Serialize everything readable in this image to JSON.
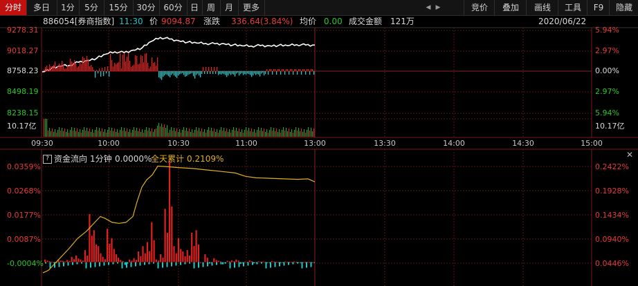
{
  "tabs": {
    "left": [
      {
        "label": "分时",
        "active": true
      },
      {
        "label": "多日",
        "active": false
      },
      {
        "label": "1分",
        "active": false
      },
      {
        "label": "5分",
        "active": false
      },
      {
        "label": "15分",
        "active": false
      },
      {
        "label": "30分",
        "active": false
      },
      {
        "label": "60分",
        "active": false
      },
      {
        "label": "日",
        "active": false
      },
      {
        "label": "周",
        "active": false
      },
      {
        "label": "月",
        "active": false
      },
      {
        "label": "更多",
        "active": false
      }
    ],
    "right": [
      {
        "label": "竞价"
      },
      {
        "label": "叠加"
      },
      {
        "label": "画线"
      },
      {
        "label": "工具"
      },
      {
        "label": "F9"
      },
      {
        "label": "隐藏"
      }
    ],
    "prev_icon": "triangle-left",
    "next_icon": "triangle-right"
  },
  "info": {
    "code_name": "886054[券商指数]",
    "time": "11:30",
    "price_label": "价",
    "price": "9094.87",
    "change_label": "涨跌",
    "change": "336.64(3.84%)",
    "avg_label": "均价",
    "avg": "0.00",
    "amount_label": "成交金额",
    "amount": "121万",
    "date": "2020/06/22"
  },
  "price_axis": {
    "left": [
      {
        "text": "9278.31",
        "color": "#e83a3a"
      },
      {
        "text": "9018.27",
        "color": "#e83a3a"
      },
      {
        "text": "8758.23",
        "color": "#dddddd"
      },
      {
        "text": "8498.19",
        "color": "#28c828"
      },
      {
        "text": "8238.15",
        "color": "#28c828"
      }
    ],
    "right": [
      {
        "text": "5.94%",
        "color": "#e83a3a"
      },
      {
        "text": "2.97%",
        "color": "#e83a3a"
      },
      {
        "text": "0.00%",
        "color": "#dddddd"
      },
      {
        "text": "2.97%",
        "color": "#28c828"
      },
      {
        "text": "5.94%",
        "color": "#28c828"
      }
    ],
    "volume_left": "10.17亿",
    "volume_right": "10.17亿"
  },
  "time_axis": [
    "09:30",
    "10:00",
    "10:30",
    "11:00",
    "13:00",
    "13:30",
    "14:00",
    "14:30",
    "15:00"
  ],
  "flow_panel": {
    "question_icon": "?",
    "title": "资金流向",
    "period": "1分钟",
    "current": "0.0000%",
    "cum_label": "全天累计",
    "cum_value": "0.2109%",
    "close_icon": "✕",
    "left_axis": [
      "0.0359%",
      "0.0268%",
      "0.0177%",
      "0.0087%",
      "-0.0004%"
    ],
    "right_axis": [
      "0.2422%",
      "0.1928%",
      "0.1434%",
      "0.0940%",
      "0.0446%"
    ]
  },
  "colors": {
    "up": "#e02020",
    "down": "#1ec8c8",
    "price_line": "#ffffff",
    "cum_line": "#e0b020",
    "grid": "#5a1515",
    "active_tab": "#c01010"
  },
  "chart_data": [
    {
      "type": "line",
      "title": "886054[券商指数]",
      "prev_close": 8758.23,
      "ylim": [
        8238.15,
        9278.31
      ],
      "session": "09:30-11:30",
      "points_sampled": [
        {
          "x": "09:30",
          "y": 8758.23
        },
        {
          "x": "09:34",
          "y": 8800
        },
        {
          "x": "09:38",
          "y": 8830
        },
        {
          "x": "09:42",
          "y": 8840
        },
        {
          "x": "09:46",
          "y": 8880
        },
        {
          "x": "09:50",
          "y": 8900
        },
        {
          "x": "09:54",
          "y": 8930
        },
        {
          "x": "09:58",
          "y": 8980
        },
        {
          "x": "10:02",
          "y": 9010
        },
        {
          "x": "10:06",
          "y": 9000
        },
        {
          "x": "10:10",
          "y": 9030
        },
        {
          "x": "10:14",
          "y": 9060
        },
        {
          "x": "10:18",
          "y": 9140
        },
        {
          "x": "10:22",
          "y": 9190
        },
        {
          "x": "10:26",
          "y": 9170
        },
        {
          "x": "10:30",
          "y": 9150
        },
        {
          "x": "10:34",
          "y": 9130
        },
        {
          "x": "10:38",
          "y": 9120
        },
        {
          "x": "10:42",
          "y": 9115
        },
        {
          "x": "10:46",
          "y": 9110
        },
        {
          "x": "10:50",
          "y": 9112
        },
        {
          "x": "10:54",
          "y": 9095
        },
        {
          "x": "10:58",
          "y": 9085
        },
        {
          "x": "11:02",
          "y": 9082
        },
        {
          "x": "11:06",
          "y": 9088
        },
        {
          "x": "11:10",
          "y": 9086
        },
        {
          "x": "11:14",
          "y": 9090
        },
        {
          "x": "11:18",
          "y": 9088
        },
        {
          "x": "11:22",
          "y": 9100
        },
        {
          "x": "11:26",
          "y": 9095
        },
        {
          "x": "11:30",
          "y": 9094.87
        }
      ]
    },
    {
      "type": "bar",
      "title": "资金流向 1分钟",
      "ylim": [
        -0.0004,
        0.0359
      ],
      "cumulative_ylim": [
        0.0446,
        0.2422
      ],
      "bars_sampled": [
        0.001,
        0.0003,
        -0.0002,
        0.001,
        0.0005,
        0.0008,
        0.002,
        0.0025,
        0.001,
        0.0045,
        0.018,
        0.012,
        0.006,
        0.002,
        0.0125,
        0.009,
        0.003,
        0.0008,
        -0.001,
        0.001,
        0.0015,
        0.004,
        0.006,
        0.0075,
        0.015,
        0.001,
        0.003,
        0.02,
        0.038,
        0.006,
        0.009,
        0.004,
        0.0045,
        0.011,
        0.012,
        0.0,
        0.003,
        -0.0005,
        0.0015,
        0.0005,
        -0.0008,
        0.0005,
        0.0007,
        0.001,
        -0.0006,
        0.0002,
        0.0006,
        -0.0004,
        0.0003,
        0.0002,
        -0.0002,
        0.0004,
        0.0001,
        -0.0002,
        0.0002,
        0.0001,
        0.0002,
        -0.0002,
        0.0001,
        0.0001,
        -0.0001
      ],
      "cumulative_end": 0.2109
    }
  ]
}
